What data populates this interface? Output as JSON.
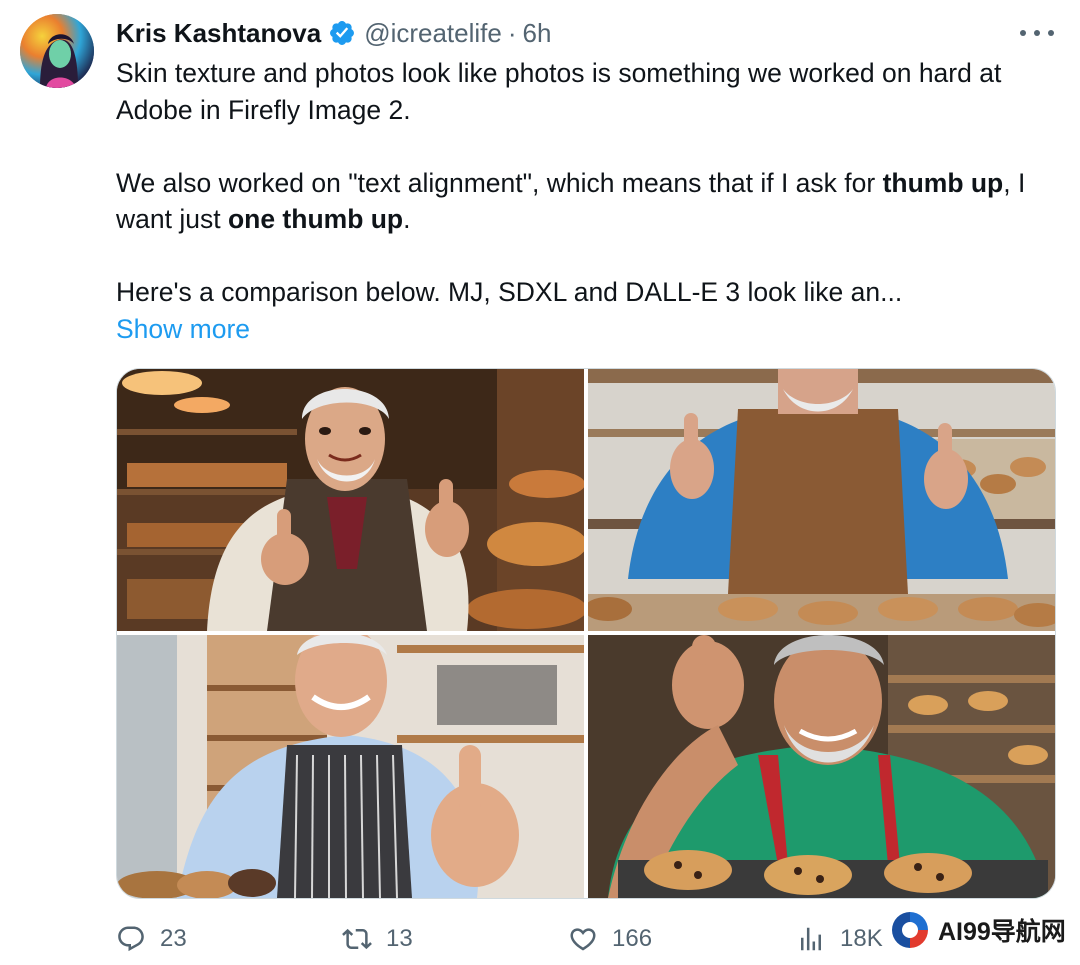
{
  "author": {
    "display_name": "Kris Kashtanova",
    "handle": "@icreatelife",
    "separator": "·",
    "time": "6h",
    "verified": true,
    "avatar_icon": "avatar-portrait"
  },
  "tweet": {
    "paragraphs": [
      {
        "segments": [
          {
            "text": "Skin texture and photos look like photos is something we worked on hard at Adobe in Firefly Image 2.",
            "bold": false
          }
        ]
      },
      {
        "segments": [
          {
            "text": "We also worked on \"text alignment\", which means that if I ask for ",
            "bold": false
          },
          {
            "text": "thumb up",
            "bold": true
          },
          {
            "text": ", I want just ",
            "bold": false
          },
          {
            "text": "one thumb up",
            "bold": true
          },
          {
            "text": ".",
            "bold": false
          }
        ]
      },
      {
        "segments": [
          {
            "text": "Here's a comparison below. MJ, SDXL and DALL-E 3 look like an...",
            "bold": false
          }
        ]
      }
    ],
    "show_more_label": "Show more"
  },
  "media": {
    "images": [
      {
        "name": "baker-image-1"
      },
      {
        "name": "baker-image-2"
      },
      {
        "name": "baker-image-3"
      },
      {
        "name": "baker-image-4"
      }
    ]
  },
  "actions": {
    "reply": {
      "icon": "reply-icon",
      "count": "23"
    },
    "retweet": {
      "icon": "retweet-icon",
      "count": "13"
    },
    "like": {
      "icon": "heart-icon",
      "count": "166"
    },
    "views": {
      "icon": "views-icon",
      "count": "18K"
    }
  },
  "watermark": {
    "text": "AI99导航网",
    "icon": "watermark-logo-icon"
  },
  "colors": {
    "text": "#0f1419",
    "secondary": "#536471",
    "link": "#1d9bf0",
    "verified": "#1d9bf0"
  }
}
